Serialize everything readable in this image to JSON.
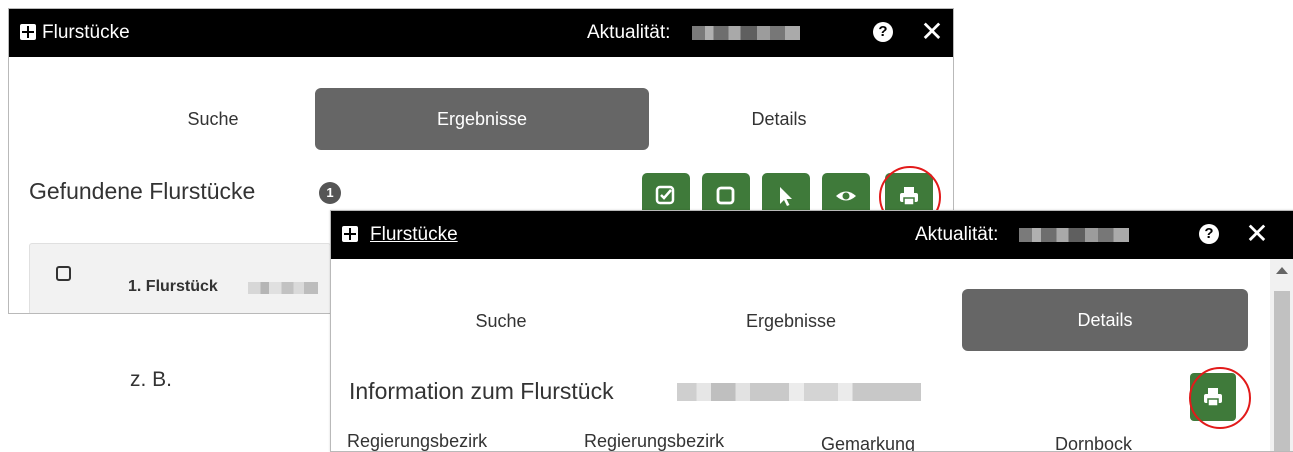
{
  "panel_back": {
    "title": "Flurstücke",
    "date_label": "Aktualität:",
    "help_symbol": "?",
    "close_symbol": "✕",
    "tabs": [
      {
        "label": "Suche",
        "active": false
      },
      {
        "label": "Ergebnisse",
        "active": true
      },
      {
        "label": "Details",
        "active": false
      }
    ],
    "heading": "Gefundene Flurstücke",
    "count": "1",
    "toolbar_icons": [
      "check-square-icon",
      "square-icon",
      "pointer-icon",
      "eye-icon",
      "print-icon"
    ],
    "result_item": {
      "label": "1. Flurstück"
    }
  },
  "panel_front": {
    "title": "Flurstücke",
    "date_label": "Aktualität:",
    "help_symbol": "?",
    "close_symbol": "✕",
    "tabs": [
      {
        "label": "Suche",
        "active": false
      },
      {
        "label": "Ergebnisse",
        "active": false
      },
      {
        "label": "Details",
        "active": true
      }
    ],
    "heading": "Information zum Flurstück",
    "attributes": [
      "Regierungsbezirk",
      "Regierungsbezirk",
      "Gemarkung",
      "Dornbock"
    ]
  },
  "caption": "z. B.",
  "colors": {
    "titlebar": "#000000",
    "active_tab": "#666666",
    "action_green": "#3f7a3a",
    "highlight_ring": "#e21a1a"
  }
}
